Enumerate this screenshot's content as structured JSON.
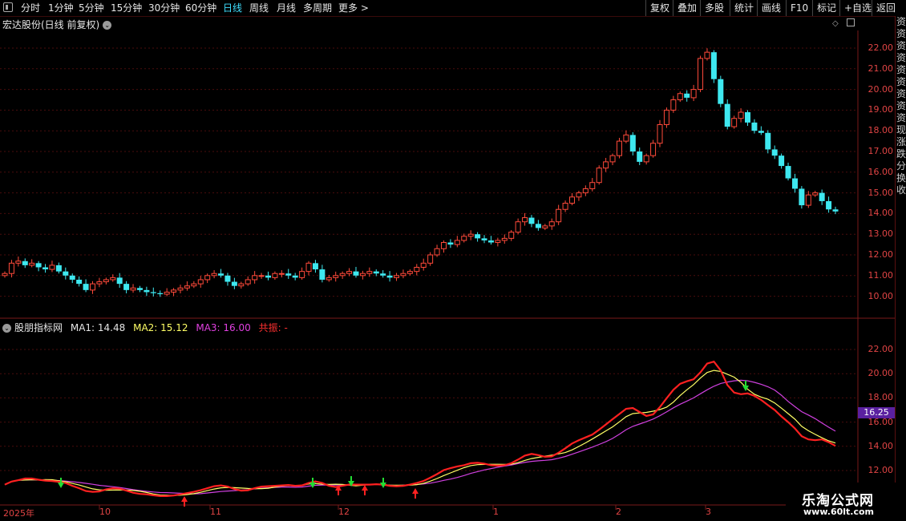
{
  "toolbar": {
    "left": [
      "分时",
      "1分钟",
      "5分钟",
      "15分钟",
      "30分钟",
      "60分钟",
      "日线",
      "周线",
      "月线",
      "多周期",
      "更多 >"
    ],
    "active": "日线",
    "right": [
      "复权",
      "叠加",
      "多股",
      "统计",
      "画线",
      "F10",
      "标记",
      "+自选",
      "返回"
    ]
  },
  "main_panel": {
    "title": "宏达股份(日线 前复权)"
  },
  "indicator_panel": {
    "name": "股朋指标网",
    "ma1": "MA1: 14.48",
    "ma2": "MA2: 15.12",
    "ma3": "MA3: 16.00",
    "resonance": "共振: -"
  },
  "price_axis": [
    "22.00",
    "21.00",
    "20.00",
    "19.00",
    "18.00",
    "17.00",
    "16.00",
    "15.00",
    "14.00",
    "13.00",
    "12.00",
    "11.00",
    "10.00"
  ],
  "indicator_axis": [
    "22.00",
    "20.00",
    "18.00",
    "16.00",
    "14.00",
    "12.00"
  ],
  "current_badge": "16.25",
  "dates": [
    "2025年",
    "10",
    "11",
    "12",
    "1",
    "2",
    "3"
  ],
  "right_strip": [
    "资",
    "资",
    "资",
    "资",
    "资",
    "资",
    "资",
    "资",
    "资",
    "现",
    "涨",
    "跌",
    "分",
    "换",
    "收"
  ],
  "watermark": {
    "name": "乐淘公式网",
    "url": "www.60lt.com"
  },
  "colors": {
    "up": "#ff4a3a",
    "down": "#3ee8f0",
    "ma1": "#ff2020",
    "ma2": "#ffff66",
    "ma3": "#d040e0",
    "grid": "#5a1010"
  },
  "chart_data": {
    "type": "candlestick",
    "close_series": [
      11.1,
      11.6,
      11.7,
      11.5,
      11.6,
      11.4,
      11.3,
      11.5,
      11.2,
      11.0,
      10.8,
      10.6,
      10.3,
      10.6,
      10.7,
      10.8,
      10.9,
      10.6,
      10.3,
      10.4,
      10.3,
      10.2,
      10.15,
      10.1,
      10.2,
      10.3,
      10.4,
      10.5,
      10.6,
      10.8,
      11.0,
      11.1,
      11.0,
      10.7,
      10.5,
      10.6,
      10.8,
      11.0,
      11.0,
      10.9,
      11.1,
      11.1,
      11.0,
      10.9,
      11.2,
      11.6,
      11.3,
      10.8,
      10.9,
      11.0,
      11.1,
      11.2,
      11.0,
      11.1,
      11.2,
      11.1,
      11.0,
      10.9,
      11.0,
      11.1,
      11.2,
      11.4,
      11.6,
      12.0,
      12.3,
      12.6,
      12.5,
      12.7,
      12.9,
      13.0,
      12.8,
      12.7,
      12.6,
      12.7,
      12.8,
      13.1,
      13.6,
      13.8,
      13.5,
      13.3,
      13.4,
      13.6,
      14.2,
      14.5,
      14.8,
      15.0,
      15.2,
      15.5,
      16.2,
      16.5,
      16.8,
      17.5,
      17.8,
      17.0,
      16.5,
      16.8,
      17.4,
      18.3,
      19.0,
      19.5,
      19.8,
      19.6,
      20.0,
      21.5,
      21.8,
      20.5,
      19.3,
      18.2,
      18.6,
      18.9,
      18.4,
      18.0,
      17.9,
      17.1,
      16.8,
      16.3,
      15.7,
      15.2,
      14.4,
      14.9,
      15.0,
      14.6,
      14.2,
      14.1
    ],
    "ma1": "MA1: 14.48",
    "ma2": "MA2: 15.12",
    "ma3": "MA3: 16.00"
  }
}
